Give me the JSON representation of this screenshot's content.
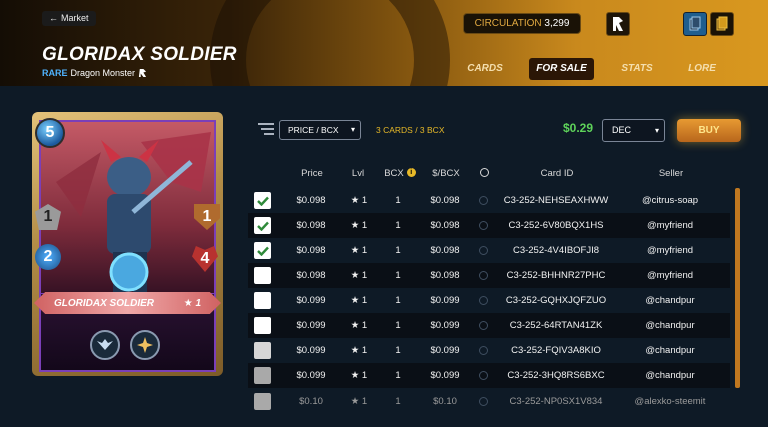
{
  "header": {
    "market_label": "Market",
    "card_name": "GLORIDAX SOLDIER",
    "rarity": "RARE",
    "type": "Dragon Monster",
    "circulation_label": "CIRCULATION",
    "circulation_value": "3,299",
    "tabs": [
      {
        "label": "CARDS",
        "active": false
      },
      {
        "label": "FOR SALE",
        "active": true
      },
      {
        "label": "STATS",
        "active": false
      },
      {
        "label": "LORE",
        "active": false
      }
    ],
    "accent_color": "#d9981f"
  },
  "card": {
    "mana": "5",
    "attack": "1",
    "armor": "1",
    "speed": "2",
    "health": "4",
    "nameplate": "GLORIDAX SOLDIER",
    "level_star": "★",
    "level": "1",
    "abilities": [
      "wing-ability-icon",
      "spark-ability-icon"
    ]
  },
  "toolbar": {
    "sort_label": "PRICE / BCX",
    "card_count": "3 CARDS / 3 BCX",
    "total_price": "$0.29",
    "currency": "DEC",
    "buy_label": "BUY"
  },
  "table": {
    "headers": {
      "price": "Price",
      "lvl": "Lvl",
      "bcx": "BCX",
      "per_bcx": "$/BCX",
      "card_id": "Card ID",
      "seller": "Seller"
    },
    "rows": [
      {
        "checked": true,
        "price": "$0.098",
        "lvl": "★ 1",
        "bcx": "1",
        "per_bcx": "$0.098",
        "card_id": "C3-252-NEHSEAXHWW",
        "seller": "@citrus-soap"
      },
      {
        "checked": true,
        "price": "$0.098",
        "lvl": "★ 1",
        "bcx": "1",
        "per_bcx": "$0.098",
        "card_id": "C3-252-6V80BQX1HS",
        "seller": "@myfriend"
      },
      {
        "checked": true,
        "price": "$0.098",
        "lvl": "★ 1",
        "bcx": "1",
        "per_bcx": "$0.098",
        "card_id": "C3-252-4V4IBOFJI8",
        "seller": "@myfriend"
      },
      {
        "checked": false,
        "price": "$0.098",
        "lvl": "★ 1",
        "bcx": "1",
        "per_bcx": "$0.098",
        "card_id": "C3-252-BHHNR27PHC",
        "seller": "@myfriend"
      },
      {
        "checked": false,
        "price": "$0.099",
        "lvl": "★ 1",
        "bcx": "1",
        "per_bcx": "$0.099",
        "card_id": "C3-252-GQHXJQFZUO",
        "seller": "@chandpur"
      },
      {
        "checked": false,
        "price": "$0.099",
        "lvl": "★ 1",
        "bcx": "1",
        "per_bcx": "$0.099",
        "card_id": "C3-252-64RTAN41ZK",
        "seller": "@chandpur"
      },
      {
        "checked": false,
        "price": "$0.099",
        "lvl": "★ 1",
        "bcx": "1",
        "per_bcx": "$0.099",
        "card_id": "C3-252-FQIV3A8KIO",
        "seller": "@chandpur"
      },
      {
        "checked": false,
        "price": "$0.099",
        "lvl": "★ 1",
        "bcx": "1",
        "per_bcx": "$0.099",
        "card_id": "C3-252-3HQ8RS6BXC",
        "seller": "@chandpur"
      },
      {
        "checked": false,
        "price": "$0.10",
        "lvl": "★ 1",
        "bcx": "1",
        "per_bcx": "$0.10",
        "card_id": "C3-252-NP0SX1V834",
        "seller": "@alexko-steemit"
      }
    ]
  }
}
